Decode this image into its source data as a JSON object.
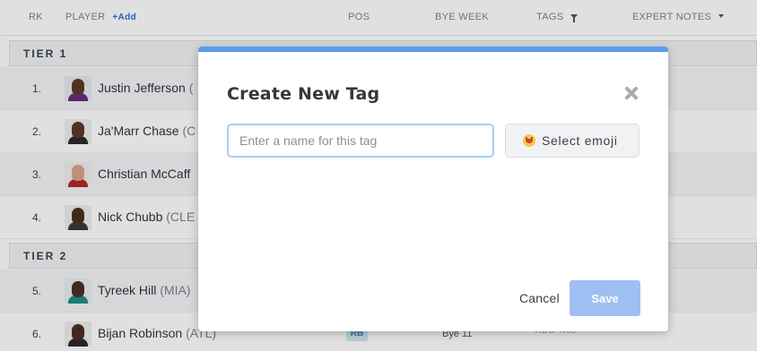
{
  "table_header": {
    "rk": "RK",
    "player": "PLAYER",
    "add": "+Add",
    "pos": "POS",
    "bye_week": "BYE WEEK",
    "tags": "TAGS",
    "expert_notes": "EXPERT NOTES"
  },
  "tiers": [
    "TIER 1",
    "TIER 2"
  ],
  "players": [
    {
      "rank": "1.",
      "name": "Justin Jefferson",
      "team": "(",
      "pos": "",
      "bye": "",
      "tag": ""
    },
    {
      "rank": "2.",
      "name": "Ja'Marr Chase",
      "team": "(C",
      "pos": "",
      "bye": "",
      "tag": ""
    },
    {
      "rank": "3.",
      "name": "Christian McCaff",
      "team": "",
      "pos": "",
      "bye": "",
      "tag": ""
    },
    {
      "rank": "4.",
      "name": "Nick Chubb",
      "team": "(CLE",
      "pos": "",
      "bye": "",
      "tag": ""
    },
    {
      "rank": "5.",
      "name": "Tyreek Hill",
      "team": "(MIA)",
      "pos": "",
      "bye": "",
      "tag": ""
    },
    {
      "rank": "6.",
      "name": "Bijan Robinson",
      "team": "(ATL)",
      "pos": "RB",
      "bye": "Bye 11",
      "tag": "ADD TAG"
    }
  ],
  "modal": {
    "title": "Create New Tag",
    "input_placeholder": "Enter a name for this tag",
    "input_value": "",
    "emoji_button_label": "Select emoji",
    "emoji_icon": "grinning-face-icon",
    "cancel_label": "Cancel",
    "save_label": "Save",
    "close_icon": "close-icon"
  },
  "colors": {
    "modal_top_bar": "#5b9bea",
    "save_button": "#9fbff3",
    "input_focus_border": "#a8cfef",
    "add_link": "#2f6ed9",
    "position_badge_bg": "#cfe6f3"
  }
}
